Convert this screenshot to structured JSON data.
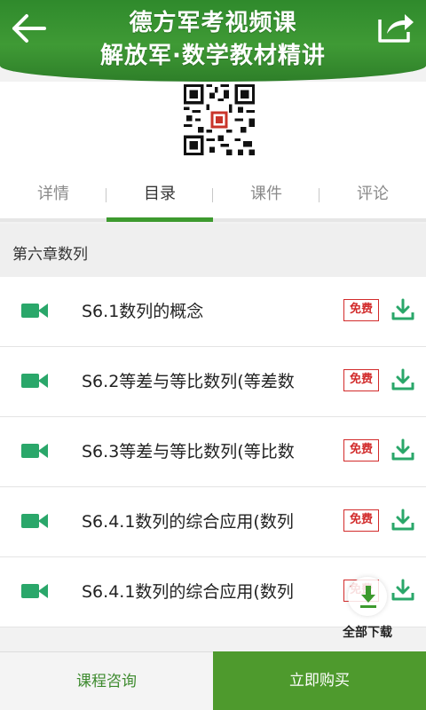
{
  "header": {
    "title_line1": "德方军考视频课",
    "title_line2": "解放军·数学教材精讲",
    "back_icon": "arrow-left-icon",
    "share_icon": "share-icon"
  },
  "qr": {
    "icon": "qr-code"
  },
  "tabs": [
    {
      "label": "详情"
    },
    {
      "label": "目录"
    },
    {
      "label": "课件"
    },
    {
      "label": "评论"
    }
  ],
  "active_tab": "目录",
  "chapter": {
    "title": "第六章数列"
  },
  "lessons": [
    {
      "name": "S6.1数列的概念",
      "badge": "免费"
    },
    {
      "name": "S6.2等差与等比数列(等差数",
      "badge": "免费"
    },
    {
      "name": "S6.3等差与等比数列(等比数",
      "badge": "免费"
    },
    {
      "name": "S6.4.1数列的综合应用(数列",
      "badge": "免费"
    },
    {
      "name": "S6.4.1数列的综合应用(数列",
      "badge": "免费"
    }
  ],
  "download_all": {
    "label": "全部下载"
  },
  "footer": {
    "consult_label": "课程咨询",
    "buy_label": "立即购买"
  },
  "colors": {
    "brand_green": "#3d9a2e",
    "free_red": "#d22b2b",
    "icon_green": "#2aa76a"
  }
}
